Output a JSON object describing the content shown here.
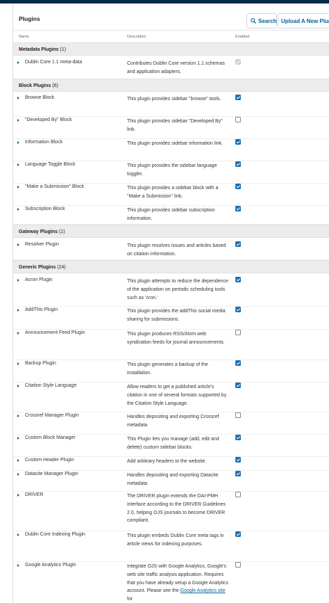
{
  "header": {
    "title": "Plugins",
    "search_label": "Search",
    "upload_label": "Upload A New Plugin"
  },
  "columns": {
    "name": "Name",
    "description": "Description",
    "enabled": "Enabled"
  },
  "categories": [
    {
      "title": "Metadata Plugins",
      "count": "(1)",
      "plugins": [
        {
          "name": "Dublin Core 1.1 meta-data",
          "desc": "Contributes Dublin Core version 1.1 schemas and application adapters.",
          "enabled": true,
          "disabled": true
        }
      ]
    },
    {
      "title": "Block Plugins",
      "count": "(6)",
      "plugins": [
        {
          "name": "Browse Block",
          "desc": "This plugin provides sidebar \"browse\" tools.",
          "enabled": true
        },
        {
          "name": "\"Developed By\" Block",
          "desc": "This plugin provides sidebar \"Developed By\" link.",
          "enabled": false
        },
        {
          "name": "Information Block",
          "desc": "This plugin provides sidebar information link.",
          "enabled": true
        },
        {
          "name": "Language Toggle Block",
          "desc": "This plugin provides the sidebar language toggler.",
          "enabled": true
        },
        {
          "name": "\"Make a Submission\" Block",
          "desc": "This plugin provides a sidebar block with a \"Make a Submission\" link.",
          "enabled": true
        },
        {
          "name": "Subscription Block",
          "desc": "This plugin provides sidebar subscription information.",
          "enabled": true
        }
      ]
    },
    {
      "title": "Gateway Plugins",
      "count": "(1)",
      "plugins": [
        {
          "name": "Resolver Plugin",
          "desc": "This plugin resolves issues and articles based on citation information.",
          "enabled": true
        }
      ]
    },
    {
      "title": "Generic Plugins",
      "count": "(24)",
      "plugins": [
        {
          "name": "Acron Plugin",
          "desc": "This plugin attempts to reduce the dependence of the application on periodic scheduling tools such as 'cron.'",
          "enabled": true
        },
        {
          "name": "AddThis Plugin",
          "desc": "This plugin provides the addThis social media sharing for submissions.",
          "enabled": true
        },
        {
          "name": "Announcement Feed Plugin",
          "desc": "This plugin produces RSS/Atom web syndication feeds for journal announcements.",
          "enabled": false
        },
        {
          "name": "Backup Plugin",
          "desc": "This plugin generates a backup of the installation.",
          "enabled": true
        },
        {
          "name": "Citation Style Language",
          "desc": "Allow readers to get a published article's citation in one of several formats supported by the Citation Style Language.",
          "enabled": true
        },
        {
          "name": "Crossref Manager Plugin",
          "desc": "Handles depositing and exporting Crossref metadata",
          "enabled": false
        },
        {
          "name": "Custom Block Manager",
          "desc": "This Plugin lets you manage (add, edit and delete) custom sidebar blocks.",
          "enabled": true
        },
        {
          "name": "Custom Header Plugin",
          "desc": "Add arbitrary headers to the website.",
          "enabled": true
        },
        {
          "name": "Datacite Manager Plugin",
          "desc": "Handles depositing and exporting Datacite metadata",
          "enabled": true
        },
        {
          "name": "DRIVER",
          "desc": "The DRIVER plugin extends the OAI-PMH interface according to the DRIVER Guidelines 2.0, helping OJS journals to become DRIVER compliant.",
          "enabled": false
        },
        {
          "name": "Dublin Core Indexing Plugin",
          "desc": "This plugin embeds Dublin Core meta tags in article views for indexing purposes.",
          "enabled": true
        },
        {
          "name": "Google Analytics Plugin",
          "desc": "Integrate OJS with Google Analytics, Google's web site traffic analysis application. Requires that you have already setup a Google Analytics account. Please see the",
          "link": "Google Analytics site",
          "desc_after": " for",
          "enabled": false
        }
      ]
    }
  ]
}
